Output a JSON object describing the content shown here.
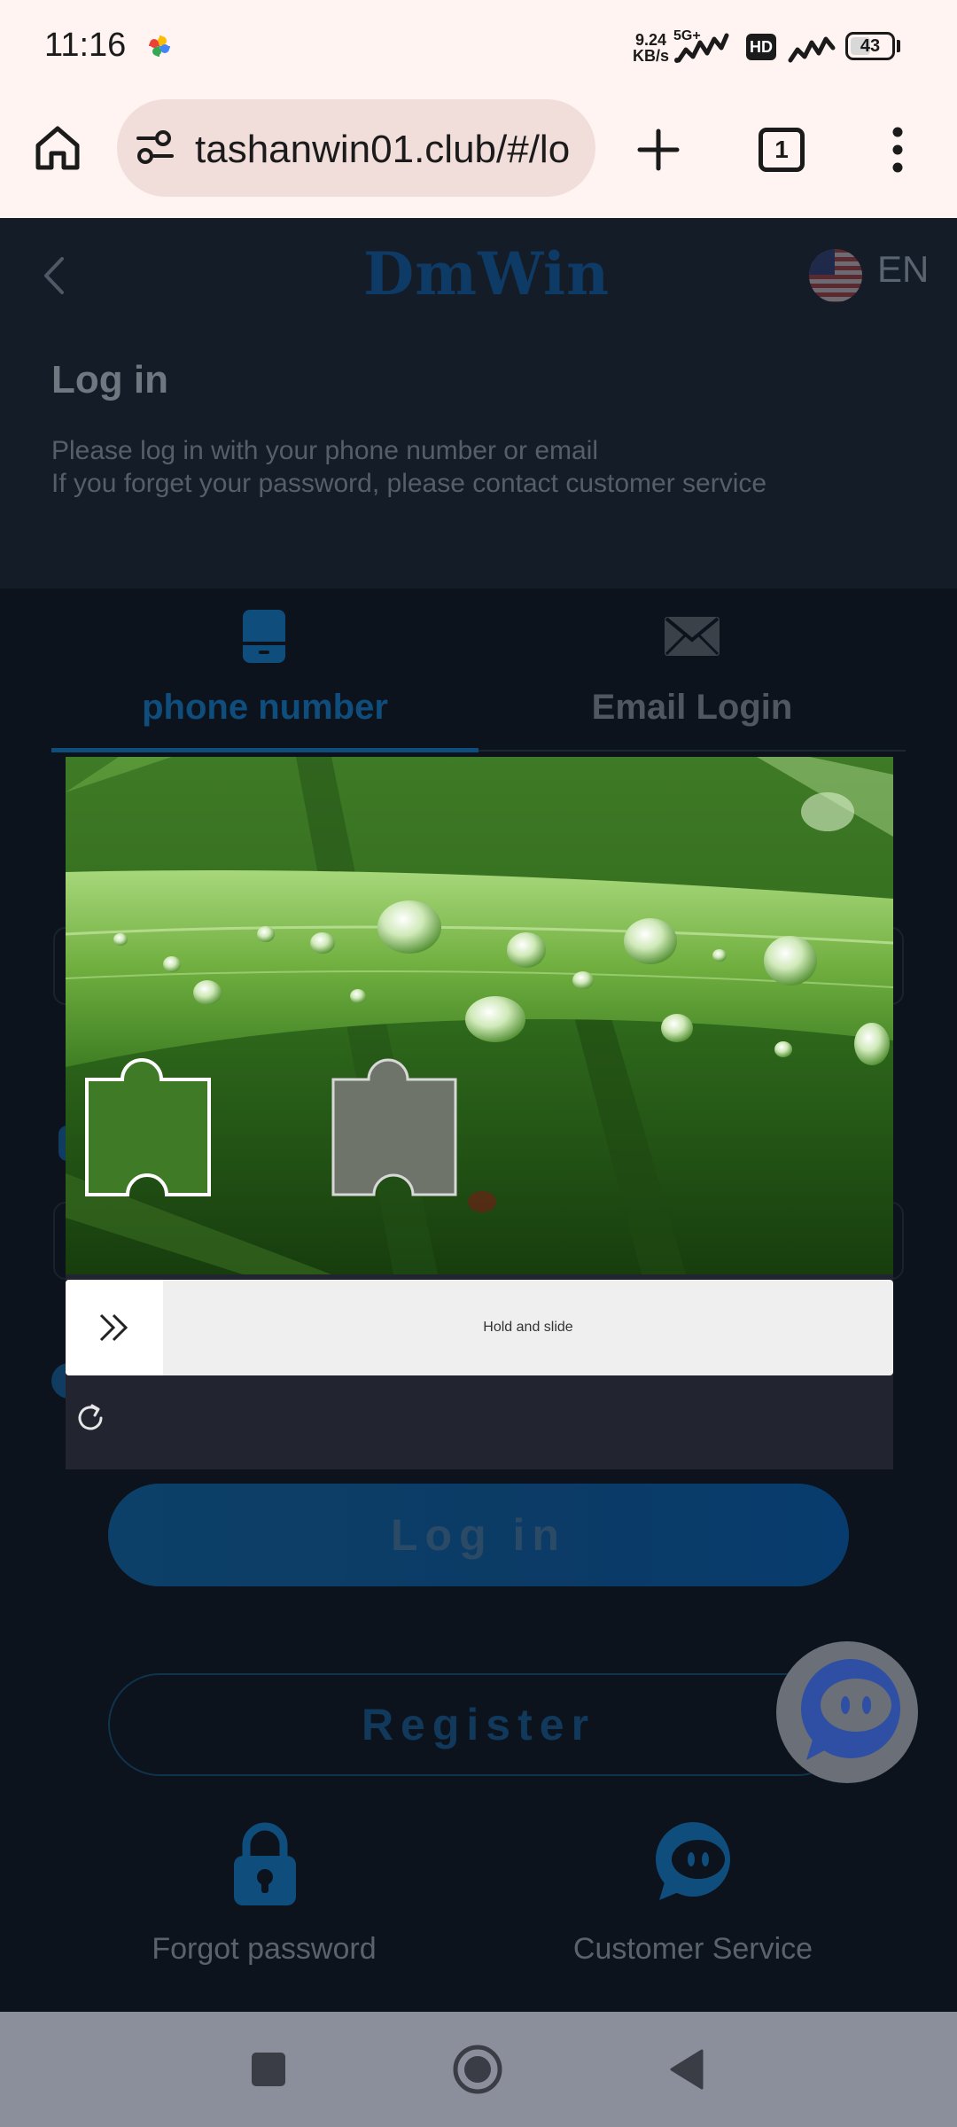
{
  "status_bar": {
    "time": "11:16",
    "net_speed_value": "9.24",
    "net_speed_unit": "KB/s",
    "network": "5G+",
    "hd": "HD",
    "battery": "43"
  },
  "browser": {
    "url": "tashanwin01.club/#/lo",
    "tab_count": "1"
  },
  "header": {
    "logo": "DmWin",
    "language": "EN"
  },
  "login": {
    "title": "Log in",
    "subtitle_line1": "Please log in with your phone number or email",
    "subtitle_line2": "If you forget your password, please contact customer service"
  },
  "tabs": [
    {
      "label": "phone number",
      "active": true
    },
    {
      "label": "Email Login",
      "active": false
    }
  ],
  "captcha": {
    "slider_text": "Hold and slide"
  },
  "buttons": {
    "login": "Log in",
    "register": "Register"
  },
  "bottom_links": [
    {
      "label": "Forgot password",
      "icon": "lock-icon"
    },
    {
      "label": "Customer Service",
      "icon": "customer-service-icon"
    }
  ],
  "colors": {
    "accent": "#0f4e7c",
    "page_background": "#0c131c",
    "status_bar": "#fff4f1"
  }
}
